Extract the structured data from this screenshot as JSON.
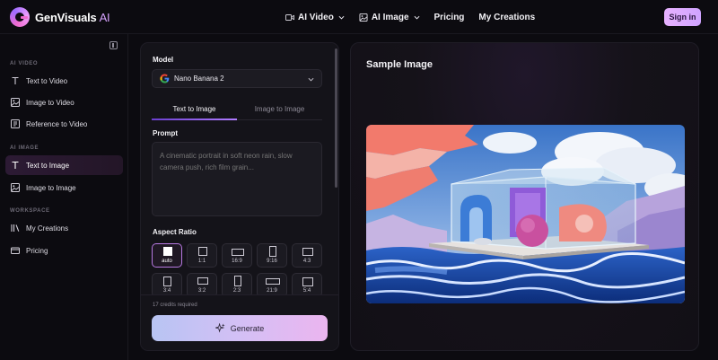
{
  "brand": {
    "name": "GenVisuals",
    "suffix": "AI"
  },
  "nav": {
    "items": [
      {
        "label": "AI Video",
        "icon": "video-icon",
        "dropdown": true
      },
      {
        "label": "AI Image",
        "icon": "image-icon",
        "dropdown": true
      },
      {
        "label": "Pricing",
        "icon": "",
        "dropdown": false
      },
      {
        "label": "My Creations",
        "icon": "",
        "dropdown": false
      }
    ],
    "signin_label": "Sign in"
  },
  "sidebar": {
    "sections": [
      {
        "label": "AI VIDEO",
        "items": [
          {
            "label": "Text to Video",
            "icon": "text-icon"
          },
          {
            "label": "Image to Video",
            "icon": "image-icon"
          },
          {
            "label": "Reference to Video",
            "icon": "reference-icon"
          }
        ]
      },
      {
        "label": "AI IMAGE",
        "items": [
          {
            "label": "Text to Image",
            "icon": "text-icon",
            "active": true
          },
          {
            "label": "Image to Image",
            "icon": "image-icon"
          }
        ]
      },
      {
        "label": "WORKSPACE",
        "items": [
          {
            "label": "My Creations",
            "icon": "library-icon"
          },
          {
            "label": "Pricing",
            "icon": "card-icon"
          }
        ]
      }
    ]
  },
  "form": {
    "model_label": "Model",
    "model_value": "Nano Banana 2",
    "tabs": [
      {
        "label": "Text to Image",
        "active": true
      },
      {
        "label": "Image to Image",
        "active": false
      }
    ],
    "prompt_label": "Prompt",
    "prompt_placeholder": "A cinematic portrait in soft neon rain, slow camera push, rich film grain...",
    "aspect_label": "Aspect Ratio",
    "ratios": [
      "auto",
      "1:1",
      "16:9",
      "9:16",
      "4:3",
      "3:4",
      "3:2",
      "2:3",
      "21:9",
      "5:4"
    ],
    "selected_ratio": "auto",
    "credits_text": "17 credits required",
    "generate_label": "Generate"
  },
  "sample": {
    "title": "Sample Image"
  },
  "colors": {
    "accent": "#b678e0",
    "brand_pink": "#f06bd0",
    "background": "#0c0b10"
  }
}
